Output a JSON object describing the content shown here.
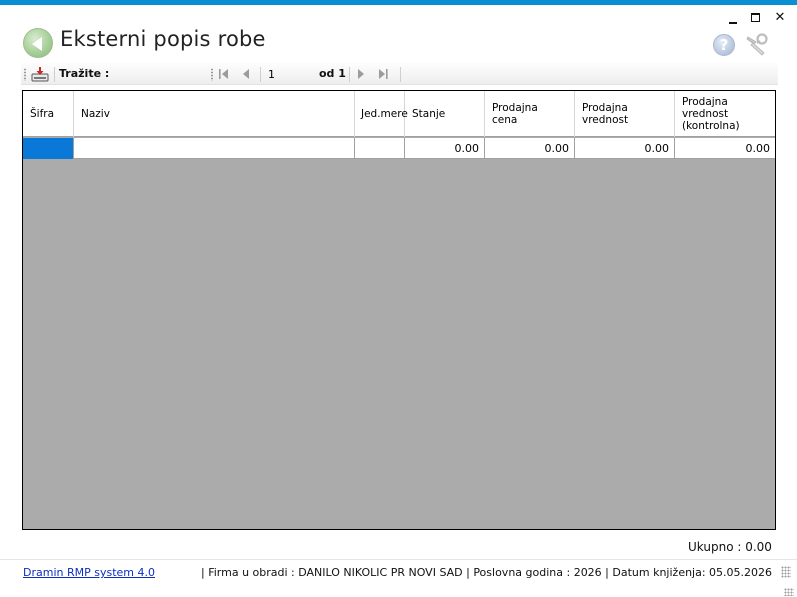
{
  "window": {
    "title": "Eksterni popis robe",
    "minimize_icon": "minimize-icon",
    "maximize_icon": "maximize-icon",
    "close_glyph": "✕",
    "accent_color": "#0a8fd3"
  },
  "toolbar": {
    "export_icon": "export-icon",
    "search_label": "Tražite :",
    "search_value": "",
    "current_page": "1",
    "of_label": "od 1"
  },
  "grid": {
    "columns": [
      {
        "label": "Šifra"
      },
      {
        "label": "Naziv"
      },
      {
        "label": "Jed.mere"
      },
      {
        "label": "Stanje"
      },
      {
        "label": "Prodajna\ncena"
      },
      {
        "label": "Prodajna\nvrednost"
      },
      {
        "label": "Prodajna\nvrednost\n(kontrolna)"
      }
    ],
    "rows": [
      {
        "sifra": "",
        "naziv": "",
        "jed_mere": "",
        "stanje": "0.00",
        "prodajna_cena": "0.00",
        "prodajna_vrednost": "0.00",
        "prodajna_vrednost_kontrolna": "0.00"
      }
    ],
    "selection_color": "#0a78d7",
    "empty_area_color": "#ababab"
  },
  "footer": {
    "total_text": "Ukupno : 0.00"
  },
  "status": {
    "link": "Dramin RMP system 4.0",
    "info": "| Firma u obradi : DANILO NIKOLIC PR NOVI SAD  |  Poslovna godina : 2026  |  Datum knjiženja: 05.05.2026"
  }
}
